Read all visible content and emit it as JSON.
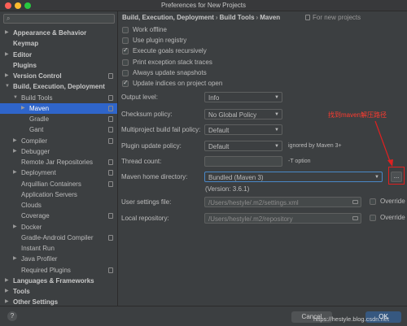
{
  "window": {
    "title": "Preferences for New Projects"
  },
  "search": {
    "placeholder": ""
  },
  "sidebar": {
    "items": [
      {
        "label": "Appearance & Behavior",
        "bold": true,
        "arrow": "▶",
        "indent": 0,
        "proj": false
      },
      {
        "label": "Keymap",
        "bold": true,
        "arrow": "",
        "indent": 0,
        "proj": false
      },
      {
        "label": "Editor",
        "bold": true,
        "arrow": "▶",
        "indent": 0,
        "proj": false
      },
      {
        "label": "Plugins",
        "bold": true,
        "arrow": "",
        "indent": 0,
        "proj": false
      },
      {
        "label": "Version Control",
        "bold": true,
        "arrow": "▶",
        "indent": 0,
        "proj": true
      },
      {
        "label": "Build, Execution, Deployment",
        "bold": true,
        "arrow": "▼",
        "indent": 0,
        "proj": false
      },
      {
        "label": "Build Tools",
        "bold": false,
        "arrow": "▼",
        "indent": 1,
        "proj": true
      },
      {
        "label": "Maven",
        "bold": false,
        "arrow": "▶",
        "indent": 2,
        "proj": true,
        "selected": true
      },
      {
        "label": "Gradle",
        "bold": false,
        "arrow": "",
        "indent": 2,
        "proj": true
      },
      {
        "label": "Gant",
        "bold": false,
        "arrow": "",
        "indent": 2,
        "proj": true
      },
      {
        "label": "Compiler",
        "bold": false,
        "arrow": "▶",
        "indent": 1,
        "proj": true
      },
      {
        "label": "Debugger",
        "bold": false,
        "arrow": "▶",
        "indent": 1,
        "proj": false
      },
      {
        "label": "Remote Jar Repositories",
        "bold": false,
        "arrow": "",
        "indent": 1,
        "proj": true
      },
      {
        "label": "Deployment",
        "bold": false,
        "arrow": "▶",
        "indent": 1,
        "proj": true
      },
      {
        "label": "Arquillian Containers",
        "bold": false,
        "arrow": "",
        "indent": 1,
        "proj": true
      },
      {
        "label": "Application Servers",
        "bold": false,
        "arrow": "",
        "indent": 1,
        "proj": false
      },
      {
        "label": "Clouds",
        "bold": false,
        "arrow": "",
        "indent": 1,
        "proj": false
      },
      {
        "label": "Coverage",
        "bold": false,
        "arrow": "",
        "indent": 1,
        "proj": true
      },
      {
        "label": "Docker",
        "bold": false,
        "arrow": "▶",
        "indent": 1,
        "proj": false
      },
      {
        "label": "Gradle-Android Compiler",
        "bold": false,
        "arrow": "",
        "indent": 1,
        "proj": true
      },
      {
        "label": "Instant Run",
        "bold": false,
        "arrow": "",
        "indent": 1,
        "proj": false
      },
      {
        "label": "Java Profiler",
        "bold": false,
        "arrow": "▶",
        "indent": 1,
        "proj": false
      },
      {
        "label": "Required Plugins",
        "bold": false,
        "arrow": "",
        "indent": 1,
        "proj": true
      },
      {
        "label": "Languages & Frameworks",
        "bold": true,
        "arrow": "▶",
        "indent": 0,
        "proj": false
      },
      {
        "label": "Tools",
        "bold": true,
        "arrow": "▶",
        "indent": 0,
        "proj": false
      },
      {
        "label": "Other Settings",
        "bold": true,
        "arrow": "▶",
        "indent": 0,
        "proj": false
      }
    ]
  },
  "main": {
    "breadcrumb": [
      "Build, Execution, Deployment",
      "Build Tools",
      "Maven"
    ],
    "for_new_projects": "For new projects",
    "checkboxes": [
      {
        "label": "Work offline",
        "checked": false
      },
      {
        "label": "Use plugin registry",
        "checked": false
      },
      {
        "label": "Execute goals recursively",
        "checked": true
      },
      {
        "label": "Print exception stack traces",
        "checked": false
      },
      {
        "label": "Always update snapshots",
        "checked": false
      },
      {
        "label": "Update indices on project open",
        "checked": true
      }
    ],
    "output_level": {
      "label": "Output level:",
      "value": "Info"
    },
    "checksum_policy": {
      "label": "Checksum policy:",
      "value": "No Global Policy"
    },
    "multiproject_fail": {
      "label": "Multiproject build fail policy:",
      "value": "Default"
    },
    "plugin_update": {
      "label": "Plugin update policy:",
      "value": "Default",
      "hint": "ignored by Maven 3+"
    },
    "thread_count": {
      "label": "Thread count:",
      "value": "",
      "hint": "-T option"
    },
    "maven_home": {
      "label": "Maven home directory:",
      "value": "Bundled (Maven 3)",
      "browse": "...",
      "version": "(Version: 3.6.1)"
    },
    "user_settings": {
      "label": "User settings file:",
      "value": "/Users/hestyle/.m2/settings.xml",
      "override": "Override"
    },
    "local_repo": {
      "label": "Local repository:",
      "value": "/Users/hestyle/.m2/repository",
      "override": "Override"
    },
    "annotation": "找到maven解压路径"
  },
  "footer": {
    "help": "?",
    "cancel": "Cancel",
    "ok": "OK",
    "watermark": "https://hestyle.blog.csdn.net"
  },
  "colors": {
    "accent": "#2f65ca",
    "annotation": "#ff3b30",
    "focus": "#4a88c7"
  }
}
